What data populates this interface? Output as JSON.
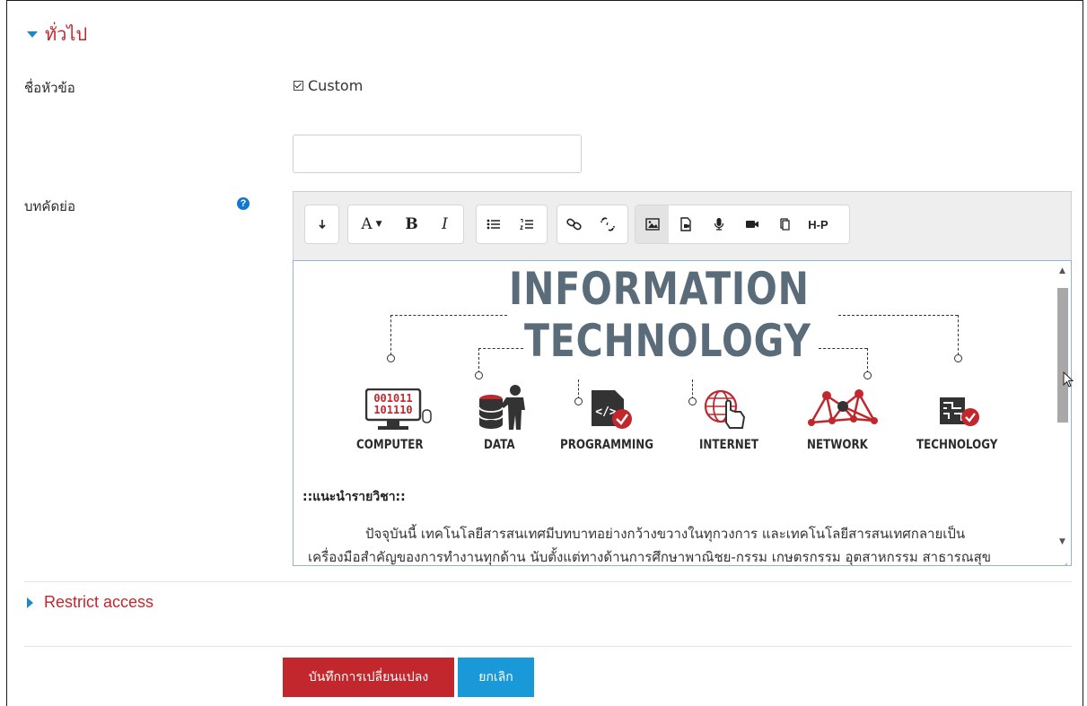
{
  "sections": {
    "general": {
      "title": "ทั่วไป"
    },
    "restrict": {
      "title": "Restrict access"
    }
  },
  "form": {
    "topic_label": "ชื่อหัวข้อ",
    "custom_label": "Custom",
    "custom_checked": true,
    "topic_value": "",
    "summary_label": "บทคัดย่อ",
    "help_glyph": "?"
  },
  "toolbar": {
    "groups": [
      [
        "toolbar-collapse-icon"
      ],
      [
        "font-color-icon",
        "bold-icon",
        "italic-icon"
      ],
      [
        "unordered-list-icon",
        "ordered-list-icon"
      ],
      [
        "link-icon",
        "unlink-icon"
      ],
      [
        "image-icon",
        "media-icon",
        "record-audio-icon",
        "record-video-icon",
        "manage-files-icon",
        "h5p-icon"
      ]
    ],
    "bold": "B",
    "italic": "I",
    "font_letter": "A",
    "h5p": "H-P"
  },
  "editor": {
    "banner_title_1": "INFORMATION",
    "banner_title_2": "TECHNOLOGY",
    "binary_1": "001011",
    "binary_2": "101110",
    "icon_labels": [
      "COMPUTER",
      "DATA",
      "PROGRAMMING",
      "INTERNET",
      "NETWORK",
      "TECHNOLOGY"
    ],
    "intro_title": "::แนะนำรายวิชา::",
    "paragraph_line1": "ปัจจุบันนี้ เทคโนโลยีสารสนเทศมีบทบาทอย่างกว้างขวางในทุกวงการ และเทคโนโลยีสารสนเทศกลายเป็น",
    "paragraph_line2": "เครื่องมือสำคัญของการทำงานทุกด้าน นับตั้งแต่ทางด้านการศึกษาพาณิชย-กรรม เกษตรกรรม อุตสาหกรรม สาธารณสุข"
  },
  "buttons": {
    "save": "บันทึกการเปลี่ยนแปลง",
    "cancel": "ยกเลิก"
  },
  "colors": {
    "accent_red": "#c1272d",
    "accent_blue": "#1a99d8",
    "caret_blue": "#1f86c8"
  }
}
